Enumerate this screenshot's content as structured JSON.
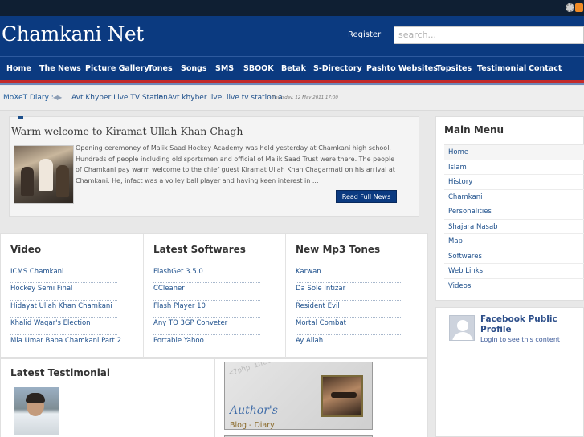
{
  "site": {
    "title": "Chamkani Net"
  },
  "header": {
    "register_label": "Register",
    "search_placeholder": "search..."
  },
  "nav": {
    "items": [
      "Home",
      "The News",
      "Picture Gallery",
      "Tones",
      "Songs",
      "SMS",
      "SBOOK",
      "Betak",
      "S-Directory",
      "Pashto Websites",
      "Topsites",
      "Testimonial",
      "Contact"
    ]
  },
  "ticker": {
    "label": "MoXeT Diary :",
    "item1": "Avt Khyber Live TV Station",
    "separator": "»",
    "item2": "Avt khyber live, live tv station a",
    "date": "- Thursday, 12 May 2011 17:00"
  },
  "feature": {
    "title": "Warm welcome to Kiramat Ullah Khan Chagh",
    "text": "Opening ceremoney of Malik Saad Hockey Academy was held yesterday at Chamkani high school. Hundreds of people including old sportsmen and official of Malik Saad Trust were there. The people of Chamkani pay warm welcome to the chief guest Kiramat Ullah Khan Chagarmati on his arrival at Chamkani. He, infact was a volley ball player and having keen interest in ...",
    "button": "Read Full News"
  },
  "columns": [
    {
      "title": "Video",
      "items": [
        "ICMS Chamkani",
        "Hockey Semi Final",
        "Hidayat Ullah Khan Chamkani",
        "Khalid Waqar's Election",
        "Mia Umar Baba Chamkani Part 2"
      ]
    },
    {
      "title": "Latest Softwares",
      "items": [
        "FlashGet 3.5.0",
        "CCleaner",
        "Flash Player 10",
        "Any TO 3GP Conveter",
        "Portable Yahoo"
      ]
    },
    {
      "title": "New Mp3 Tones",
      "items": [
        "Karwan",
        "Da Sole Intizar",
        "Resident Evil",
        "Mortal Combat",
        "Ay Allah"
      ]
    }
  ],
  "testimonial": {
    "title": "Latest Testimonial"
  },
  "author_box": {
    "code_text": "<?php include('blog_moxet');",
    "title": "Author's",
    "subtitle": "Blog - Diary"
  },
  "sidebar": {
    "title": "Main Menu",
    "items": [
      "Home",
      "Islam",
      "History",
      "Chamkani",
      "Personalities",
      "Shajara Nasab",
      "Map",
      "Softwares",
      "Web Links",
      "Videos"
    ]
  },
  "facebook": {
    "title": "Facebook Public Profile",
    "login": "Login to see this content"
  },
  "colors": {
    "brand_blue": "#0b3a80",
    "accent_red": "#c32a2a",
    "link_blue": "#1d4f8b"
  },
  "icons": {
    "settings": "gear-icon",
    "feed": "rss-icon"
  }
}
